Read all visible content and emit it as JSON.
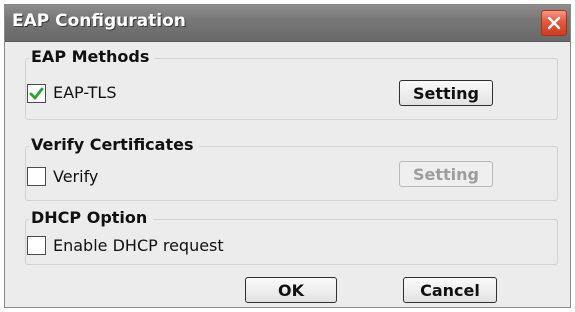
{
  "dialog": {
    "title": "EAP Configuration"
  },
  "eap_methods": {
    "group_title": "EAP Methods",
    "eap_tls": {
      "label": "EAP-TLS",
      "checked": true
    },
    "setting_button": "Setting"
  },
  "verify_certificates": {
    "group_title": "Verify Certificates",
    "verify": {
      "label": "Verify",
      "checked": false
    },
    "setting_button": "Setting"
  },
  "dhcp_option": {
    "group_title": "DHCP Option",
    "enable_dhcp": {
      "label": "Enable DHCP request",
      "checked": false
    }
  },
  "footer": {
    "ok_label": "OK",
    "cancel_label": "Cancel"
  },
  "colors": {
    "titlebar": "#777777",
    "close_button": "#e2583d",
    "check_mark": "#2aa52a",
    "dialog_background": "#ececec"
  }
}
